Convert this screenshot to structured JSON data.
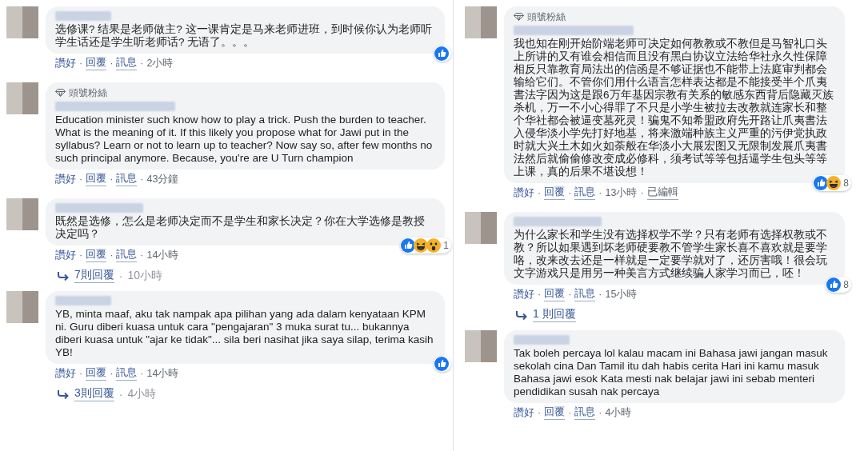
{
  "separator": "·",
  "columns": [
    {
      "comments": [
        {
          "text": "选修课? 结果是老师做主? 这一课肯定是马来老师进班，到时候你认为老师听学生话还是学生听老师话? 无语了。。。",
          "actions": [
            "讚好",
            "回覆",
            "訊息"
          ],
          "time": "2小時",
          "reactions": [
            {
              "kind": "like"
            }
          ]
        },
        {
          "badge": "頭號粉絲",
          "text": "Education minister such know how to play a trick. Push the burden to teacher. What is the meaning of it. If this likely you propose what for Jawi put in the syllabus? Learn or not to learn up to teacher? Now say so, after few months no such principal anymore. Because, you're are U Turn champion",
          "actions": [
            "讚好",
            "回覆",
            "訊息"
          ],
          "time": "43分鐘"
        },
        {
          "text": "既然是选修，怎么是老师决定而不是学生和家长决定？你在大学选修是教授决定吗？",
          "actions": [
            "讚好",
            "回覆",
            "訊息"
          ],
          "time": "14小時",
          "reactions": [
            {
              "kind": "like"
            },
            {
              "kind": "haha"
            },
            {
              "kind": "wow"
            }
          ],
          "reaction_count": "1",
          "replies": {
            "label": "7則回覆",
            "time": "10小時"
          }
        },
        {
          "text": "YB, minta maaf, aku tak nampak apa pilihan yang ada dalam kenyataan KPM ni. Guru diberi kuasa untuk cara \"pengajaran\" 3 muka surat tu... bukannya diberi kuasa untuk \"ajar ke tidak\"... sila beri nasihat jika saya silap, terima kasih YB!",
          "actions": [
            "讚好",
            "回覆",
            "訊息"
          ],
          "time": "14小時",
          "reactions": [
            {
              "kind": "like"
            }
          ],
          "replies": {
            "label": "3則回覆",
            "time": "4小時"
          }
        }
      ]
    },
    {
      "comments": [
        {
          "badge": "頭號粉絲",
          "text": "我也知在刚开始阶端老师可决定如何教教或不教但是马智礼口头上所讲的又有谁会相信而且没有黑白协议立法给华社永久性保障相反只靠教育局法出的信函是不够证据也不能带上法庭审判都会输给它们。不管你们用什么语言怎样表达都是不能接受半个爪夷書法字因为这是跟6万年基因宗教有关系的敏感东西背后隐藏灭族杀机，万一不小心得罪了不只是小学生被拉去改教就连家长和整个华社都会被逼变墓死灵！骗鬼不知希盟政府先开路让爪夷書法入侵华淡小学先打好地基，将来激端种族主义严重的污伊党执政时就大兴土木如火如荼般在华淡小大展宏图又无限制发展爪夷書法然后就偷偷修改变成必修科，须考试等等包括逼学生包头等等上课，真的后果不堪设想！",
          "actions": [
            "讚好",
            "回覆",
            "訊息"
          ],
          "time": "13小時",
          "edited": "已編輯",
          "reactions": [
            {
              "kind": "like"
            },
            {
              "kind": "haha"
            }
          ],
          "reaction_count": "8"
        },
        {
          "text": "为什么家长和学生没有选择权学不学？只有老师有选择权教或不教？所以如果遇到坏老师硬要教不管学生家长喜不喜欢就是要学咯，改来改去还是一样就是一定要学就对了，还厉害哦！很会玩文字游戏只是用另一种美言方式继续骗人家学习而已，呸！",
          "actions": [
            "讚好",
            "回覆",
            "訊息"
          ],
          "time": "15小時",
          "reactions": [
            {
              "kind": "like"
            }
          ],
          "reaction_count": "8",
          "replies": {
            "label": "1 則回覆"
          }
        },
        {
          "text": "Tak boleh percaya lol kalau macam ini Bahasa jawi jangan masuk sekolah cina Dan Tamil itu dah habis cerita Hari ini kamu masuk Bahasa jawi esok Kata mesti nak belajar jawi ini sebab menteri pendidikan susah nak percaya",
          "actions": [
            "讚好",
            "回覆",
            "訊息"
          ],
          "time": "4小時"
        }
      ]
    }
  ]
}
